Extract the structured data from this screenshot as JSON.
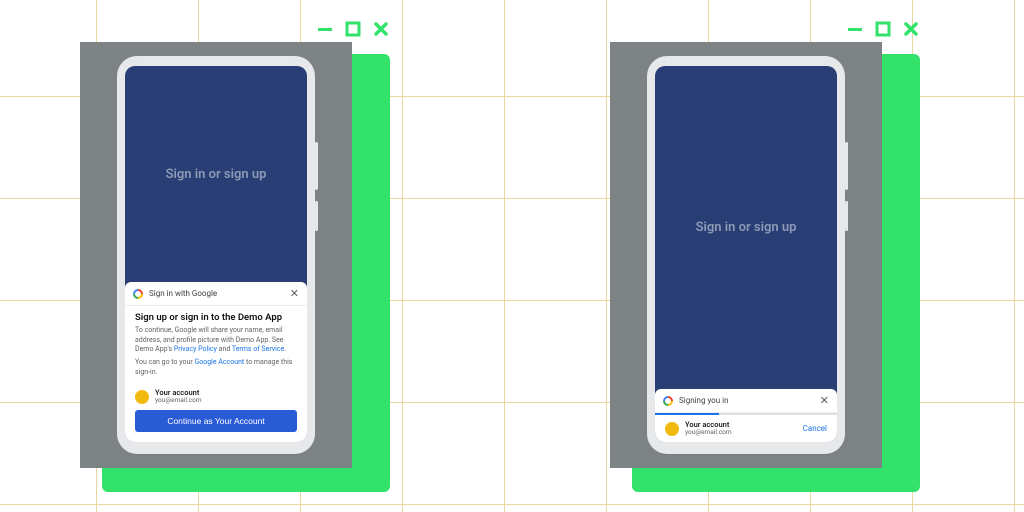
{
  "window_controls": {
    "minimize": "minimize",
    "maximize": "maximize",
    "close": "close"
  },
  "hero_text": "Sign in or sign up",
  "sheet_a": {
    "header": "Sign in with Google",
    "title": "Sign up or sign in to the Demo App",
    "desc_pre": "To continue, Google will share your name, email address, and profile picture with Demo App. See Demo App's ",
    "privacy": "Privacy Policy",
    "and": " and ",
    "tos": "Terms of Service",
    "desc_post": ".",
    "desc2_pre": "You can go to your ",
    "google_account": "Google Account",
    "desc2_post": " to manage this sign-in.",
    "cta": "Continue as Your Account"
  },
  "sheet_b": {
    "header": "Signing you in",
    "progress_pct": 35,
    "cancel": "Cancel"
  },
  "account": {
    "name": "Your account",
    "email": "you@email.com"
  },
  "colors": {
    "accent_green": "#33e26b",
    "app_blue": "#283e74",
    "link_blue": "#1a73e8",
    "primary_btn": "#2a5bd7"
  }
}
